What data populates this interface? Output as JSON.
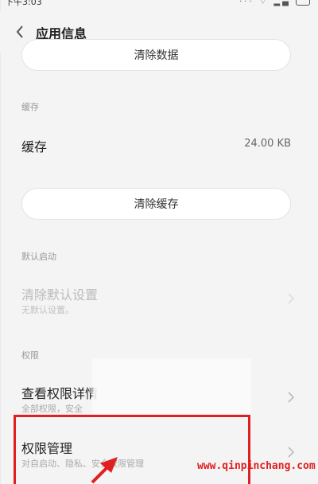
{
  "status_bar": {
    "time": "下午3:03",
    "icons": [
      "signal-icon",
      "wifi-icon",
      "cell-signal-icon",
      "battery-icon"
    ]
  },
  "header": {
    "title": "应用信息",
    "back_icon": "back-chevron-icon"
  },
  "clear_data_button": "清除数据",
  "cache_section": {
    "label": "缓存",
    "row_title": "缓存",
    "row_value": "24.00 KB",
    "clear_button": "清除缓存"
  },
  "default_section": {
    "label": "默认启动",
    "row_title": "清除默认设置",
    "row_sub": "无默认设置。"
  },
  "permissions_section": {
    "label": "权限",
    "detail_title": "查看权限详情",
    "detail_sub": "全部权限，安全",
    "manage_title": "权限管理",
    "manage_sub": "对自启动、隐私、安全权限管理"
  },
  "watermark": "www.qinpinchang.com",
  "colors": {
    "background": "#f4f4f4",
    "highlight": "#e02020"
  }
}
